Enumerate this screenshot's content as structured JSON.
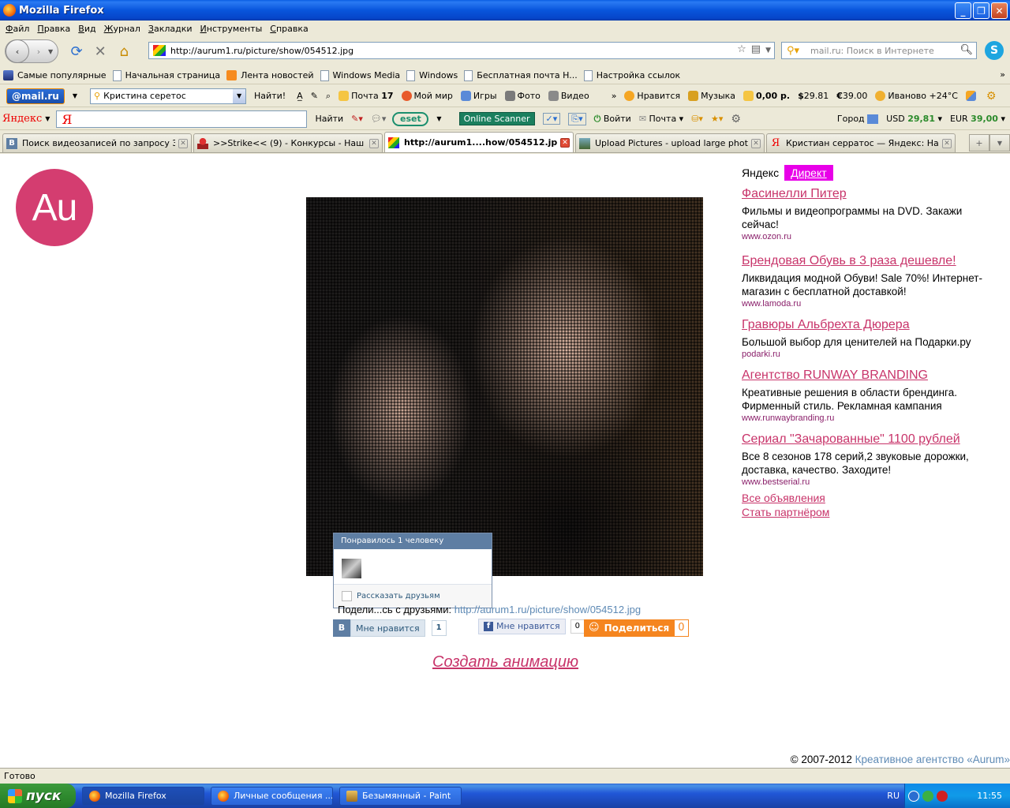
{
  "window": {
    "title": "Mozilla Firefox"
  },
  "menu": [
    "Файл",
    "Правка",
    "Вид",
    "Журнал",
    "Закладки",
    "Инструменты",
    "Справка"
  ],
  "nav": {
    "url": "http://aurum1.ru/picture/show/054512.jpg",
    "search_placeholder": "mail.ru: Поиск в Интернете"
  },
  "bookmarks": [
    "Самые популярные",
    "Начальная страница",
    "Лента новостей",
    "Windows Media",
    "Windows",
    "Бесплатная почта H...",
    "Настройка ссылок"
  ],
  "mailru": {
    "logo": "@mail.ru",
    "search_value": "Кристина  серетос",
    "find": "Найти!",
    "mail": "Почта",
    "mail_count": "17",
    "myworld": "Мой мир",
    "games": "Игры",
    "photo": "Фото",
    "video": "Видео",
    "more": "»",
    "likes": "Нравится",
    "music": "Музыка",
    "balance": "0,00 р.",
    "usd": "29.81",
    "eur": "39.00",
    "weather": "Иваново +24°C"
  },
  "yandex": {
    "logo": "Яндекс",
    "find": "Найти",
    "eset": "eset",
    "online_scanner": "Online Scanner",
    "login": "Войти",
    "mail": "Почта",
    "city": "Город",
    "usd_label": "USD",
    "usd": "29,81",
    "eur_label": "EUR",
    "eur": "39,00"
  },
  "tabs": [
    {
      "title": "Поиск видеозаписей по запросу Зач...",
      "active": false
    },
    {
      "title": ">>Strike<< (9) - Конкурсы - Наш до...",
      "active": false
    },
    {
      "title": "http://aurum1....how/054512.jpg",
      "active": true
    },
    {
      "title": "Upload Pictures - upload large photos ...",
      "active": false
    },
    {
      "title": "Кристиан серратос — Яндекс: Нашл...",
      "active": false
    }
  ],
  "page": {
    "logo": "Au",
    "like_popup": {
      "header": "Понравилось 1 человеку",
      "tell_friends": "Рассказать друзьям"
    },
    "share_prefix": "Подели...сь с друзьями:",
    "share_link": "http://aurum1.ru/picture/show/054512.jpg",
    "vk": {
      "letter": "В",
      "label": "Мне нравится",
      "count": "1"
    },
    "fb": {
      "label": "Мне нравится",
      "count": "0"
    },
    "ok": {
      "label": "Поделиться",
      "count": "0"
    },
    "create_animation": "Создать анимацию",
    "copyright_prefix": "© 2007-2012",
    "copyright_link": "Креативное агентство «Aurum»"
  },
  "ads": {
    "brand": "Яндекс",
    "direct": "Директ",
    "items": [
      {
        "title": "Фасинелли Питер",
        "body": "Фильмы и видеопрограммы на DVD. Закажи сейчас!",
        "url": "www.ozon.ru"
      },
      {
        "title": "Брендовая Обувь в 3 раза дешевле!",
        "body": "Ликвидация модной Обуви! Sale 70%! Интернет-магазин с бесплатной доставкой!",
        "url": "www.lamoda.ru"
      },
      {
        "title": "Гравюры Альбрехта Дюрера",
        "body": "Большой выбор для ценителей на Подарки.ру",
        "url": "podarki.ru"
      },
      {
        "title": "Агентство RUNWAY BRANDING",
        "body": "Креативные решения в области брендинга. Фирменный стиль. Рекламная кампания",
        "url": "www.runwaybranding.ru"
      },
      {
        "title": "Сериал \"Зачарованные\" 1100 рублей",
        "body": "Все 8 сезонов 178 серий,2 звуковые дорожки, доставка, качество. Заходите!",
        "url": "www.bestserial.ru"
      }
    ],
    "all_ads": "Все объявления",
    "become_partner": "Стать партнёром"
  },
  "status": "Готово",
  "taskbar": {
    "start": "пуск",
    "items": [
      "Mozilla Firefox",
      "Личные сообщения ...",
      "Безымянный - Paint"
    ],
    "lang": "RU",
    "clock": "11:55"
  }
}
